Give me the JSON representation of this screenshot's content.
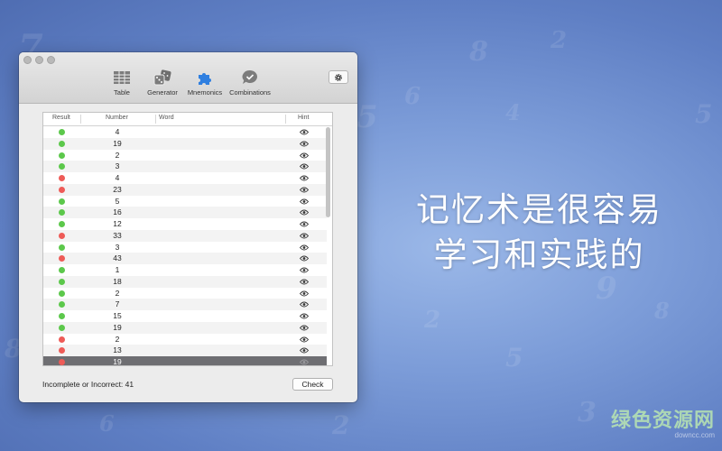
{
  "window": {
    "toolbar": [
      {
        "label": "Table",
        "icon": "table-icon"
      },
      {
        "label": "Generator",
        "icon": "dice-icon"
      },
      {
        "label": "Mnemonics",
        "icon": "puzzle-icon"
      },
      {
        "label": "Combinations",
        "icon": "speech-check-icon"
      }
    ],
    "selected_toolbar": "Mnemonics",
    "settings_icon": "gear-icon"
  },
  "table": {
    "columns": [
      "Result",
      "Number",
      "Word",
      "Hint"
    ],
    "rows": [
      {
        "result": "green",
        "number": "4"
      },
      {
        "result": "green",
        "number": "19"
      },
      {
        "result": "green",
        "number": "2"
      },
      {
        "result": "green",
        "number": "3"
      },
      {
        "result": "red",
        "number": "4"
      },
      {
        "result": "red",
        "number": "23"
      },
      {
        "result": "green",
        "number": "5"
      },
      {
        "result": "green",
        "number": "16"
      },
      {
        "result": "green",
        "number": "12"
      },
      {
        "result": "red",
        "number": "33"
      },
      {
        "result": "green",
        "number": "3"
      },
      {
        "result": "red",
        "number": "43"
      },
      {
        "result": "green",
        "number": "1"
      },
      {
        "result": "green",
        "number": "18"
      },
      {
        "result": "green",
        "number": "2"
      },
      {
        "result": "green",
        "number": "7"
      },
      {
        "result": "green",
        "number": "15"
      },
      {
        "result": "green",
        "number": "19"
      },
      {
        "result": "red",
        "number": "2"
      },
      {
        "result": "red",
        "number": "13"
      },
      {
        "result": "red",
        "number": "19"
      }
    ],
    "selected_row_index": 20,
    "hint_icon": "eye-icon"
  },
  "status": {
    "text": "Incomplete or Incorrect: 41"
  },
  "buttons": {
    "check": "Check"
  },
  "headline": {
    "line1": "记忆术是很容易",
    "line2": "学习和实践的"
  },
  "watermark": {
    "text": "绿色资源网",
    "url": "downcc.com"
  },
  "colors": {
    "accent": "#2f7fe0",
    "green": "#5cc84b",
    "red": "#ee5b57",
    "selected_row": "#6e6e72"
  }
}
